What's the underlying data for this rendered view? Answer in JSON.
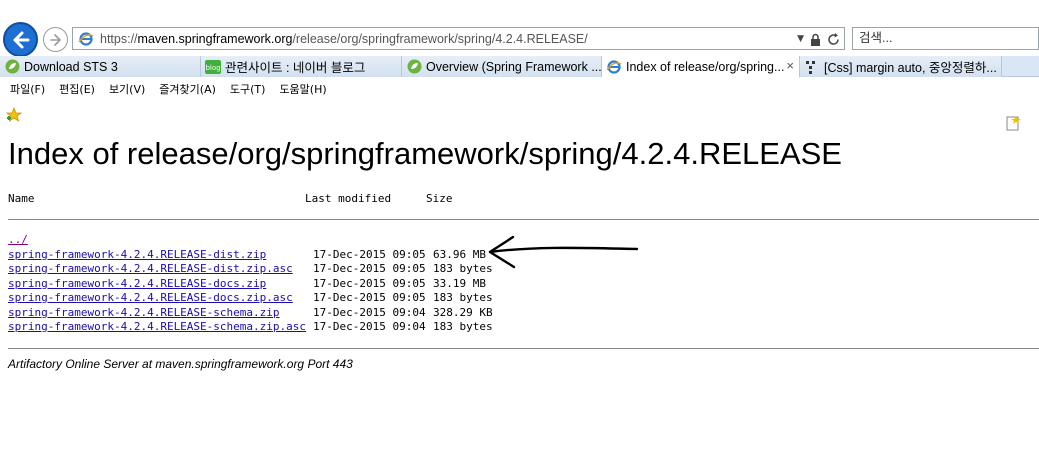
{
  "browser": {
    "url": {
      "scheme": "https://",
      "domain": "maven.springframework.org",
      "path": "/release/org/springframework/spring/4.2.4.RELEASE/"
    },
    "search_placeholder": "검색...",
    "tabs": [
      {
        "label": "Download STS 3",
        "icon": "spring-leaf-icon",
        "active": false
      },
      {
        "label": "관련사이트 : 네이버 블로그",
        "icon": "naver-blog-icon",
        "active": false
      },
      {
        "label": "Overview (Spring Framework ...",
        "icon": "spring-leaf-icon",
        "active": false
      },
      {
        "label": "Index of release/org/spring...",
        "icon": "ie-page-icon",
        "active": true,
        "close": "×"
      },
      {
        "label": "[Css] margin auto, 중앙정렬하...",
        "icon": "dots-icon",
        "active": false
      }
    ],
    "menu": [
      "파일(F)",
      "편집(E)",
      "보기(V)",
      "즐겨찾기(A)",
      "도구(T)",
      "도움말(H)"
    ],
    "colors": {
      "back_button": "#1d6fd1",
      "tab_bar": "#d9e6f5",
      "link": "#1a0dab",
      "visited_link": "#800080"
    }
  },
  "page": {
    "title": "Index of release/org/springframework/spring/4.2.4.RELEASE",
    "columns": {
      "name": "Name",
      "modified": "Last modified",
      "size": "Size"
    },
    "parent_link": "../",
    "files": [
      {
        "name": "spring-framework-4.2.4.RELEASE-dist.zip",
        "modified": "17-Dec-2015 09:05",
        "size": "63.96 MB"
      },
      {
        "name": "spring-framework-4.2.4.RELEASE-dist.zip.asc",
        "modified": "17-Dec-2015 09:05",
        "size": "183 bytes"
      },
      {
        "name": "spring-framework-4.2.4.RELEASE-docs.zip",
        "modified": "17-Dec-2015 09:05",
        "size": "33.19 MB"
      },
      {
        "name": "spring-framework-4.2.4.RELEASE-docs.zip.asc",
        "modified": "17-Dec-2015 09:05",
        "size": "183 bytes"
      },
      {
        "name": "spring-framework-4.2.4.RELEASE-schema.zip",
        "modified": "17-Dec-2015 09:04",
        "size": "328.29 KB"
      },
      {
        "name": "spring-framework-4.2.4.RELEASE-schema.zip.asc",
        "modified": "17-Dec-2015 09:04",
        "size": "183 bytes"
      }
    ],
    "footer": "Artifactory Online Server at maven.springframework.org Port 443"
  }
}
